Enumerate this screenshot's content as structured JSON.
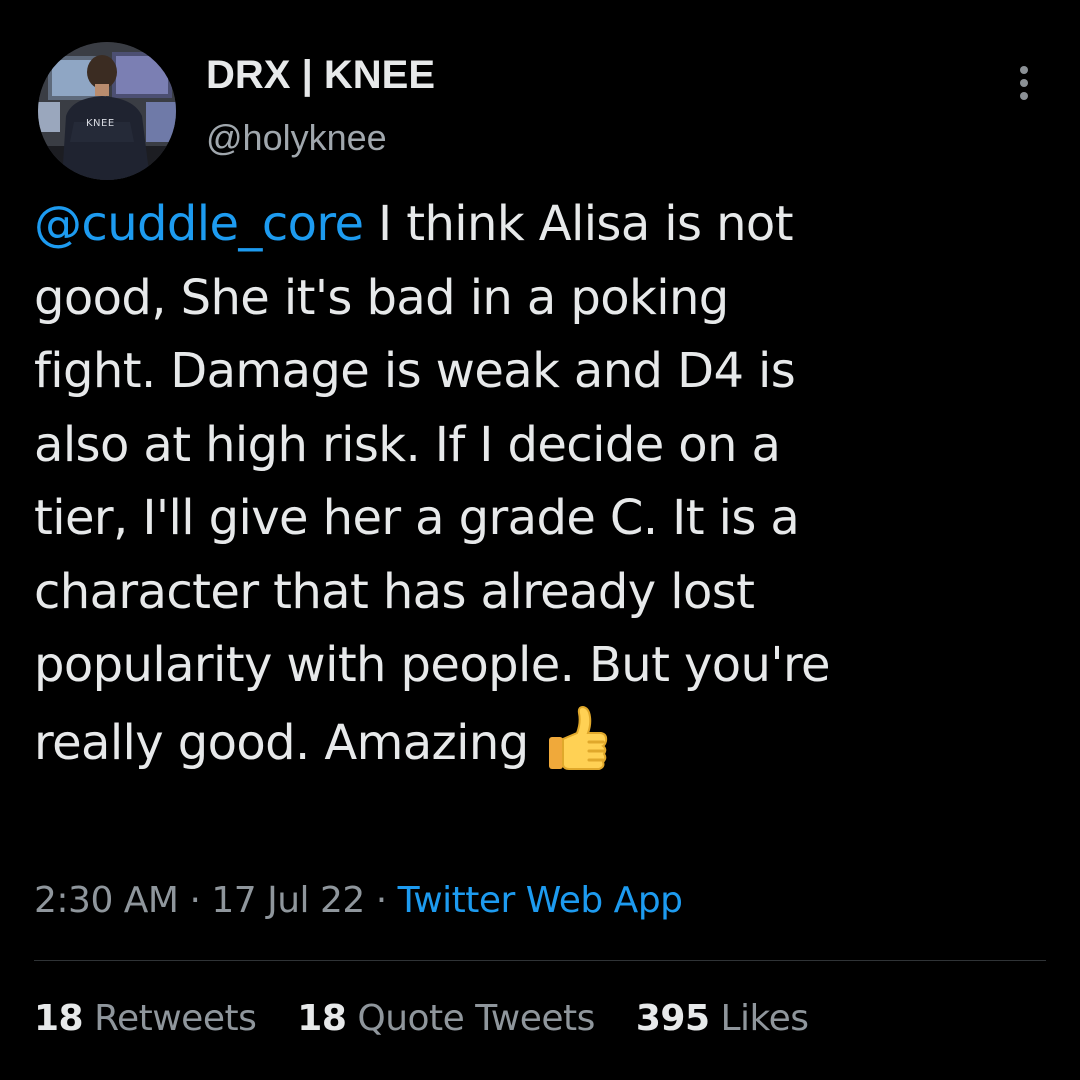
{
  "author": {
    "display_name": "DRX | KNEE",
    "handle": "@holyknee",
    "avatar_icon": "profile-photo"
  },
  "tweet": {
    "mention": "@cuddle_core",
    "lines": [
      " I think Alisa is not",
      "good, She it's bad in a poking",
      "fight. Damage is weak and D4 is",
      "also at high risk. If I decide on a",
      "tier, I'll give her a grade C. It is a",
      "character that has already lost",
      "popularity with people. But you're",
      "really good. Amazing"
    ],
    "emoji": "thumbs-up-emoji"
  },
  "meta": {
    "time": "2:30 AM",
    "separator": "·",
    "date": "17 Jul 22",
    "source": "Twitter Web App"
  },
  "stats": {
    "retweets_count": "18",
    "retweets_label": "Retweets",
    "quotes_count": "18",
    "quotes_label": "Quote Tweets",
    "likes_count": "395",
    "likes_label": "Likes"
  },
  "colors": {
    "background": "#000000",
    "text": "#e7e9ea",
    "secondary": "#8f969c",
    "link": "#1d9bf0",
    "divider": "#2f3336"
  },
  "more_icon": "more-vertical-icon"
}
